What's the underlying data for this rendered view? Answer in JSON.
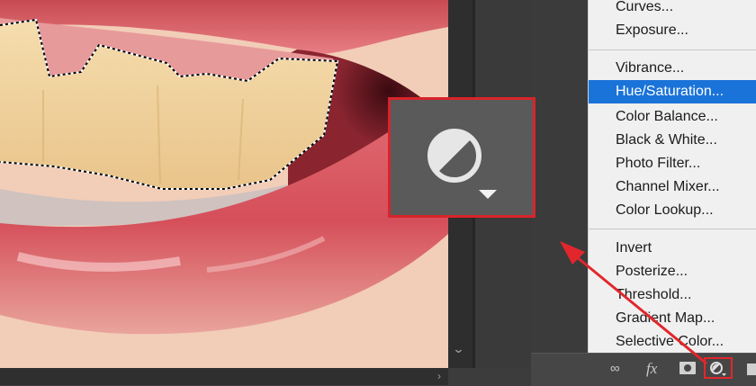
{
  "menu": {
    "groups": [
      [
        "Curves...",
        "Exposure..."
      ],
      [
        "Vibrance...",
        "Hue/Saturation...",
        "Color Balance...",
        "Black & White...",
        "Photo Filter...",
        "Channel Mixer...",
        "Color Lookup..."
      ],
      [
        "Invert",
        "Posterize...",
        "Threshold...",
        "Gradient Map...",
        "Selective Color..."
      ]
    ],
    "highlighted_item": "Hue/Saturation..."
  },
  "bottom_bar": {
    "icons": [
      "link-icon",
      "fx-icon",
      "add-mask-icon",
      "adjustment-layer-icon",
      "delete-icon"
    ],
    "fx_label": "fx"
  },
  "colors": {
    "highlight": "#1a73d8",
    "callout_border": "#d8242a"
  }
}
